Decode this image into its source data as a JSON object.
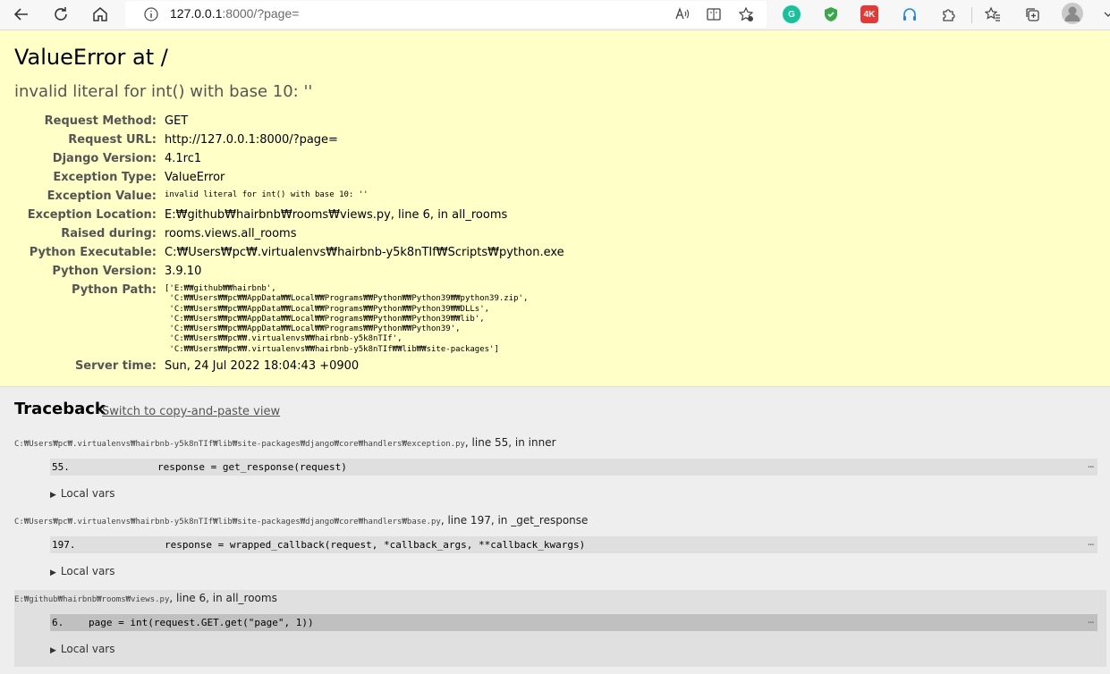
{
  "browser": {
    "url_host": "127.0.0.1",
    "url_rest": ":8000/?page="
  },
  "summary": {
    "title": "ValueError at /",
    "subtitle": "invalid literal for int() with base 10: ''",
    "meta": [
      {
        "label": "Request Method:",
        "value": "GET"
      },
      {
        "label": "Request URL:",
        "value": "http://127.0.0.1:8000/?page="
      },
      {
        "label": "Django Version:",
        "value": "4.1rc1"
      },
      {
        "label": "Exception Type:",
        "value": "ValueError"
      },
      {
        "label": "Exception Value:",
        "value": "invalid literal for int() with base 10: ''"
      },
      {
        "label": "Exception Location:",
        "value": "E:₩github₩hairbnb₩rooms₩views.py, line 6, in all_rooms"
      },
      {
        "label": "Raised during:",
        "value": "rooms.views.all_rooms"
      },
      {
        "label": "Python Executable:",
        "value": "C:₩Users₩pc₩.virtualenvs₩hairbnb-y5k8nTIf₩Scripts₩python.exe"
      },
      {
        "label": "Python Version:",
        "value": "3.9.10"
      },
      {
        "label": "Python Path:",
        "value": "['E:₩₩github₩₩hairbnb',\n 'C:₩₩Users₩₩pc₩₩AppData₩₩Local₩₩Programs₩₩Python₩₩Python39₩₩python39.zip',\n 'C:₩₩Users₩₩pc₩₩AppData₩₩Local₩₩Programs₩₩Python₩₩Python39₩₩DLLs',\n 'C:₩₩Users₩₩pc₩₩AppData₩₩Local₩₩Programs₩₩Python₩₩Python39₩₩lib',\n 'C:₩₩Users₩₩pc₩₩AppData₩₩Local₩₩Programs₩₩Python₩₩Python39',\n 'C:₩₩Users₩₩pc₩₩.virtualenvs₩₩hairbnb-y5k8nTIf',\n 'C:₩₩Users₩₩pc₩₩.virtualenvs₩₩hairbnb-y5k8nTIf₩₩lib₩₩site-packages']"
      },
      {
        "label": "Server time:",
        "value": "Sun, 24 Jul 2022 18:04:43 +0900"
      }
    ]
  },
  "traceback": {
    "title": "Traceback",
    "switch_link": "Switch to copy-and-paste view",
    "local_vars_label": "Local vars",
    "context_ellipsis": "…",
    "frames": [
      {
        "path": "C:₩Users₩pc₩.virtualenvs₩hairbnb-y5k8nTIf₩lib₩site-packages₩django₩core₩handlers₩exception.py",
        "location": ", line 55, in inner",
        "line_no": "55.",
        "code": "response = get_response(request)"
      },
      {
        "path": "C:₩Users₩pc₩.virtualenvs₩hairbnb-y5k8nTIf₩lib₩site-packages₩django₩core₩handlers₩base.py",
        "location": ", line 197, in _get_response",
        "line_no": "197.",
        "code": "response = wrapped_callback(request, *callback_args, **callback_kwargs)"
      },
      {
        "path": "E:₩github₩hairbnb₩rooms₩views.py",
        "location": ", line 6, in all_rooms",
        "line_no": "6.",
        "code": "page = int(request.GET.get(\"page\", 1))"
      }
    ]
  }
}
